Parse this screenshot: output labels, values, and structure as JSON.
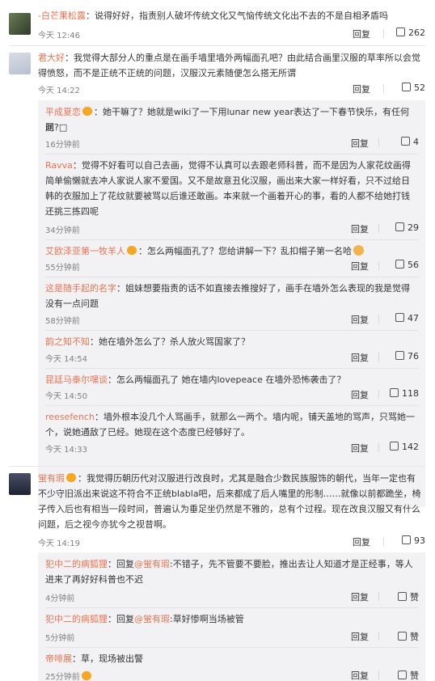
{
  "reply_label": "回复",
  "like_label": "赞",
  "colon": "：",
  "comments": [
    {
      "name": "-白芒果松露",
      "text": "说得好好，指责别人破坏传统文化又气恼传统文化出不去的不是自相矛盾吗",
      "time": "今天 12:46",
      "likes": "262"
    },
    {
      "name": "君大好",
      "text_1": "我觉得大部分人的重点是在画手墙里墙外两幅面孔吧？由此结合画里汉服的草率所以会觉",
      "text_2": "得愤怒，而不是正统不正统的问题，汉服汉元素随便怎么搭无所谓",
      "time": "今天 14:22",
      "likes": "52"
    },
    {
      "name": "蛍有瑕",
      "text_1": "我觉得历朝历代对汉服进行改良时，尤其是融合少数民族服饰的朝代，当年一定也有",
      "text_2": "不少守旧派出来说这不符合不正统blabla吧，后来都成了后人嘴里的形制……就像以前都跪坐，椅",
      "text_3": "子传入后也有相当一段时间，普遍认为垂足坐仍然是不雅的，总有个过程。现在改良汉服又有什么",
      "text_4": "问题，后之视今亦犹今之视昔啊。",
      "time": "今天 14:19",
      "likes": "93"
    }
  ],
  "replies_a": [
    {
      "name": "平成夏恋",
      "text_1": "她干嘛了？她就是wiki了一下用lunar new year表达了一下春节快乐，有任何问",
      "text_2": "题?□",
      "time": "16分钟前",
      "likes": "4"
    },
    {
      "name": "Ravva",
      "text_1": "觉得不好看可以自己去画，觉得不认真可以去跟老师科普，而不是因为人家花纹画得",
      "text_2": "简单偷懒就去冲人家说人家不爱国。又不是故意丑化汉服，画出来大家一样好看，只不过给日",
      "text_3": "韩的衣服加上了花纹就要被骂以后谁还敢画。本来就一个画着开心的事，看的人都不给她打钱",
      "text_4": "还挑三拣四呢",
      "time": "34分钟前",
      "likes": "29"
    },
    {
      "name": "艾欧泽亚第一牧羊人",
      "text": "怎么两幅面孔了？您给讲解一下？乱扣帽子第一名哈",
      "time": "55分钟前",
      "likes": "56"
    },
    {
      "name": "这是随手起的名字",
      "text_1": "姐妹想要指责的话不如直接去推搜好了，画手在墙外怎么表现的我是觉得",
      "text_2": "没有一点问题",
      "time": "58分钟前",
      "likes": "47"
    },
    {
      "name": "韵之知不知",
      "text": "她在墙外怎么了？杀人放火骂国家了？",
      "time": "今天 14:54",
      "likes": "76"
    },
    {
      "name": "昆廷马泰尔嘿谈",
      "text": "怎么两幅面孔了  她在墙内lovepeace  在墙外恐怖袭击了？",
      "time": "今天 14:50",
      "likes": "118"
    },
    {
      "name": "reesefench",
      "text_1": "墙外根本没几个人骂画手，就那么一两个。墙内呢，铺天盖地的骂声，只骂她一",
      "text_2": "个，说她通敌了已经。她现在这个态度已经够好了。",
      "time": "今天 14:33",
      "likes": "142"
    }
  ],
  "replies_b": [
    {
      "name": "犯中二的病狐狸",
      "mention": "@蛍有瑕",
      "text_1": ":不错子，先不管要不要脸，推出去让人知道才是正经事，等人",
      "text_2": "进来了再好好科普也不迟",
      "time": "4分钟前"
    },
    {
      "name": "犯中二的病狐狸",
      "mention": "@蛍有瑕",
      "text": ":草好惨啊当场被管",
      "time": "5分钟前"
    },
    {
      "name": "帝啡展",
      "text": "草，现场被出警",
      "time": "25分钟前"
    }
  ],
  "colors": {
    "name": "#eb7350",
    "text": "#333333",
    "meta": "#808080",
    "sub_bg": "#f2f2f5"
  }
}
